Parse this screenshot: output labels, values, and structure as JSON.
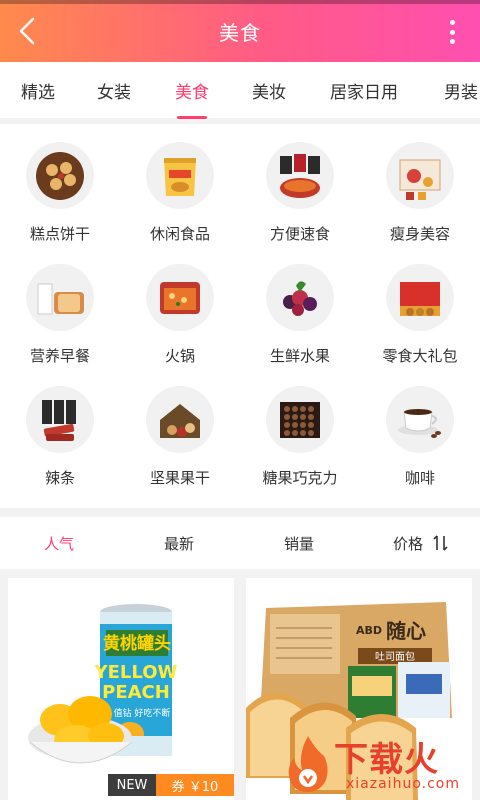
{
  "header": {
    "title": "美食",
    "back_icon": "chevron-left-icon",
    "more_icon": "more-vertical-icon"
  },
  "tabs": [
    {
      "label": "精选",
      "active": false
    },
    {
      "label": "女装",
      "active": false
    },
    {
      "label": "美食",
      "active": true
    },
    {
      "label": "美妆",
      "active": false
    },
    {
      "label": "居家日用",
      "active": false
    },
    {
      "label": "男装",
      "active": false
    }
  ],
  "categories": [
    {
      "label": "糕点饼干",
      "icon": "cookies-icon"
    },
    {
      "label": "休闲食品",
      "icon": "snack-bag-icon"
    },
    {
      "label": "方便速食",
      "icon": "instant-noodles-icon"
    },
    {
      "label": "瘦身美容",
      "icon": "health-box-icon"
    },
    {
      "label": "营养早餐",
      "icon": "bread-milk-icon"
    },
    {
      "label": "火锅",
      "icon": "hotpot-icon"
    },
    {
      "label": "生鲜水果",
      "icon": "fruit-icon"
    },
    {
      "label": "零食大礼包",
      "icon": "gift-box-icon"
    },
    {
      "label": "辣条",
      "icon": "spicy-strips-icon"
    },
    {
      "label": "坚果果干",
      "icon": "nuts-icon"
    },
    {
      "label": "糖果巧克力",
      "icon": "chocolate-box-icon"
    },
    {
      "label": "咖啡",
      "icon": "coffee-cup-icon"
    }
  ],
  "sort": {
    "popular": "人气",
    "newest": "最新",
    "sales": "销量",
    "price": "价格",
    "price_icon": "sort-arrows-icon"
  },
  "products": [
    {
      "name": "canned-yellow-peach",
      "can_label_cn": "黄桃罐头",
      "can_label_en1": "YELLOW",
      "can_label_en2": "PEACH",
      "can_slogan": "值钻 好吃不断",
      "badge_new": "NEW",
      "coupon": "券 ￥10"
    },
    {
      "name": "toast-bread-box",
      "box_label": "随心",
      "box_sub": "吐司面包",
      "brand": "ABD"
    }
  ],
  "watermark": {
    "text": "下载火",
    "sub": "xiazaihuo.com"
  },
  "colors": {
    "accent": "#ff3d6e",
    "header_start": "#ff8a4c",
    "header_end": "#ff4fb0",
    "coupon": "#ff8a1f"
  }
}
